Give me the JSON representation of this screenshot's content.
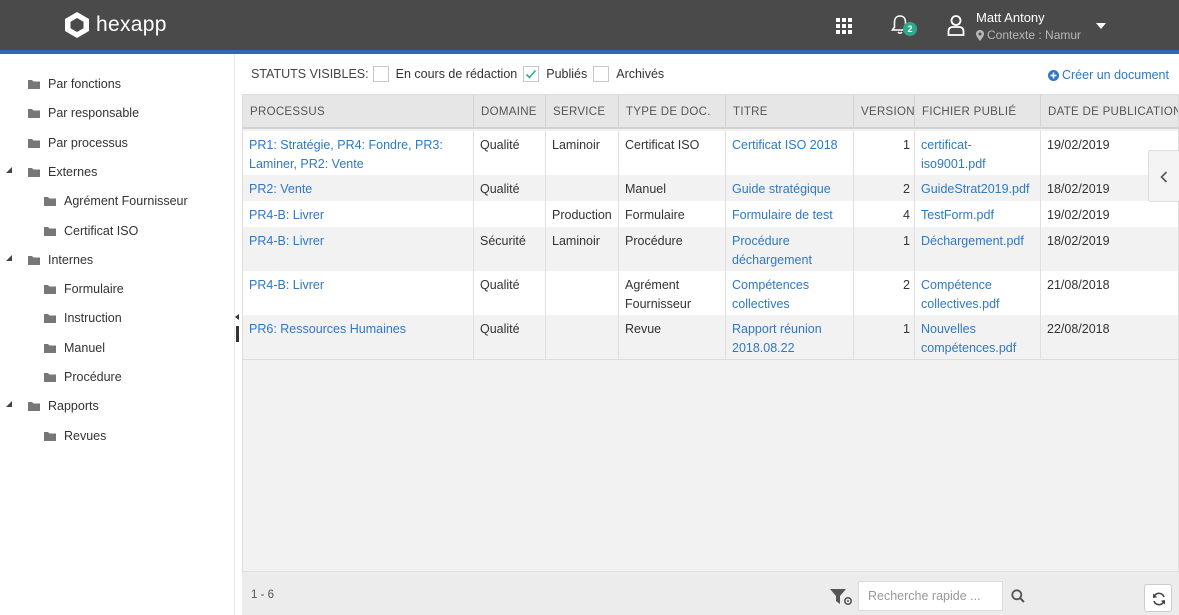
{
  "app": {
    "name": "hexapp"
  },
  "header": {
    "notification_count": "2",
    "user_name": "Matt Antony",
    "user_context": "Contexte : Namur"
  },
  "sidebar": {
    "items": [
      {
        "label": "Par fonctions",
        "level": 0,
        "expandable": false
      },
      {
        "label": "Par responsable",
        "level": 0,
        "expandable": false
      },
      {
        "label": "Par processus",
        "level": 0,
        "expandable": false
      },
      {
        "label": "Externes",
        "level": 0,
        "expandable": true
      },
      {
        "label": "Agrément Fournisseur",
        "level": 1,
        "expandable": false
      },
      {
        "label": "Certificat ISO",
        "level": 1,
        "expandable": false
      },
      {
        "label": "Internes",
        "level": 0,
        "expandable": true
      },
      {
        "label": "Formulaire",
        "level": 1,
        "expandable": false
      },
      {
        "label": "Instruction",
        "level": 1,
        "expandable": false
      },
      {
        "label": "Manuel",
        "level": 1,
        "expandable": false
      },
      {
        "label": "Procédure",
        "level": 1,
        "expandable": false
      },
      {
        "label": "Rapports",
        "level": 0,
        "expandable": true
      },
      {
        "label": "Revues",
        "level": 1,
        "expandable": false
      }
    ]
  },
  "filters": {
    "label": "STATUTS VISIBLES:",
    "options": [
      {
        "label": "En cours de rédaction",
        "checked": false
      },
      {
        "label": "Publiés",
        "checked": true
      },
      {
        "label": "Archivés",
        "checked": false
      }
    ],
    "create_label": "Créer un document"
  },
  "table": {
    "columns": [
      "PROCESSUS",
      "DOMAINE",
      "SERVICE",
      "TYPE DE DOC.",
      "TITRE",
      "VERSION",
      "FICHIER PUBLIÉ",
      "DATE DE PUBLICATION"
    ],
    "rows": [
      {
        "processus": "PR1: Stratégie, PR4: Fondre, PR3: Laminer, PR2: Vente",
        "domaine": "Qualité",
        "service": "Laminoir",
        "type": "Certificat ISO",
        "titre": "Certificat ISO 2018",
        "version": "1",
        "fichier": "certificat-iso9001.pdf",
        "date": "19/02/2019"
      },
      {
        "processus": "PR2: Vente",
        "domaine": "Qualité",
        "service": "",
        "type": "Manuel",
        "titre": "Guide stratégique",
        "version": "2",
        "fichier": "GuideStrat2019.pdf",
        "date": "18/02/2019"
      },
      {
        "processus": "PR4-B: Livrer",
        "domaine": "",
        "service": "Production",
        "type": "Formulaire",
        "titre": "Formulaire de test",
        "version": "4",
        "fichier": "TestForm.pdf",
        "date": "19/02/2019"
      },
      {
        "processus": "PR4-B: Livrer",
        "domaine": "Sécurité",
        "service": "Laminoir",
        "type": "Procédure",
        "titre": "Procédure déchargement",
        "version": "1",
        "fichier": "Déchargement.pdf",
        "date": "18/02/2019"
      },
      {
        "processus": "PR4-B: Livrer",
        "domaine": "Qualité",
        "service": "",
        "type": "Agrément Fournisseur",
        "titre": "Compétences collectives",
        "version": "2",
        "fichier": "Compétence collectives.pdf",
        "date": "21/08/2018"
      },
      {
        "processus": "PR6: Ressources Humaines",
        "domaine": "Qualité",
        "service": "",
        "type": "Revue",
        "titre": "Rapport réunion 2018.08.22",
        "version": "1",
        "fichier": "Nouvelles compétences.pdf",
        "date": "22/08/2018"
      }
    ]
  },
  "footer": {
    "count": "1 - 6",
    "search_placeholder": "Recherche rapide ..."
  },
  "icons": {
    "logo": "hexagon-icon",
    "apps": "grid-icon",
    "notifications": "bell-icon",
    "user": "user-icon",
    "context": "map-marker-icon",
    "menu": "caret-down-icon",
    "folder": "folder-icon",
    "create": "plus-circle-icon",
    "panel": "chevron-left-icon",
    "filter": "filter-settings-icon",
    "search": "search-icon",
    "refresh": "refresh-icon"
  },
  "colors": {
    "topbar": "#4a4a4a",
    "accent": "#2f68b5",
    "link": "#2f78c4",
    "badge": "#2ea98a",
    "checkbox_check": "#2ea98a"
  }
}
